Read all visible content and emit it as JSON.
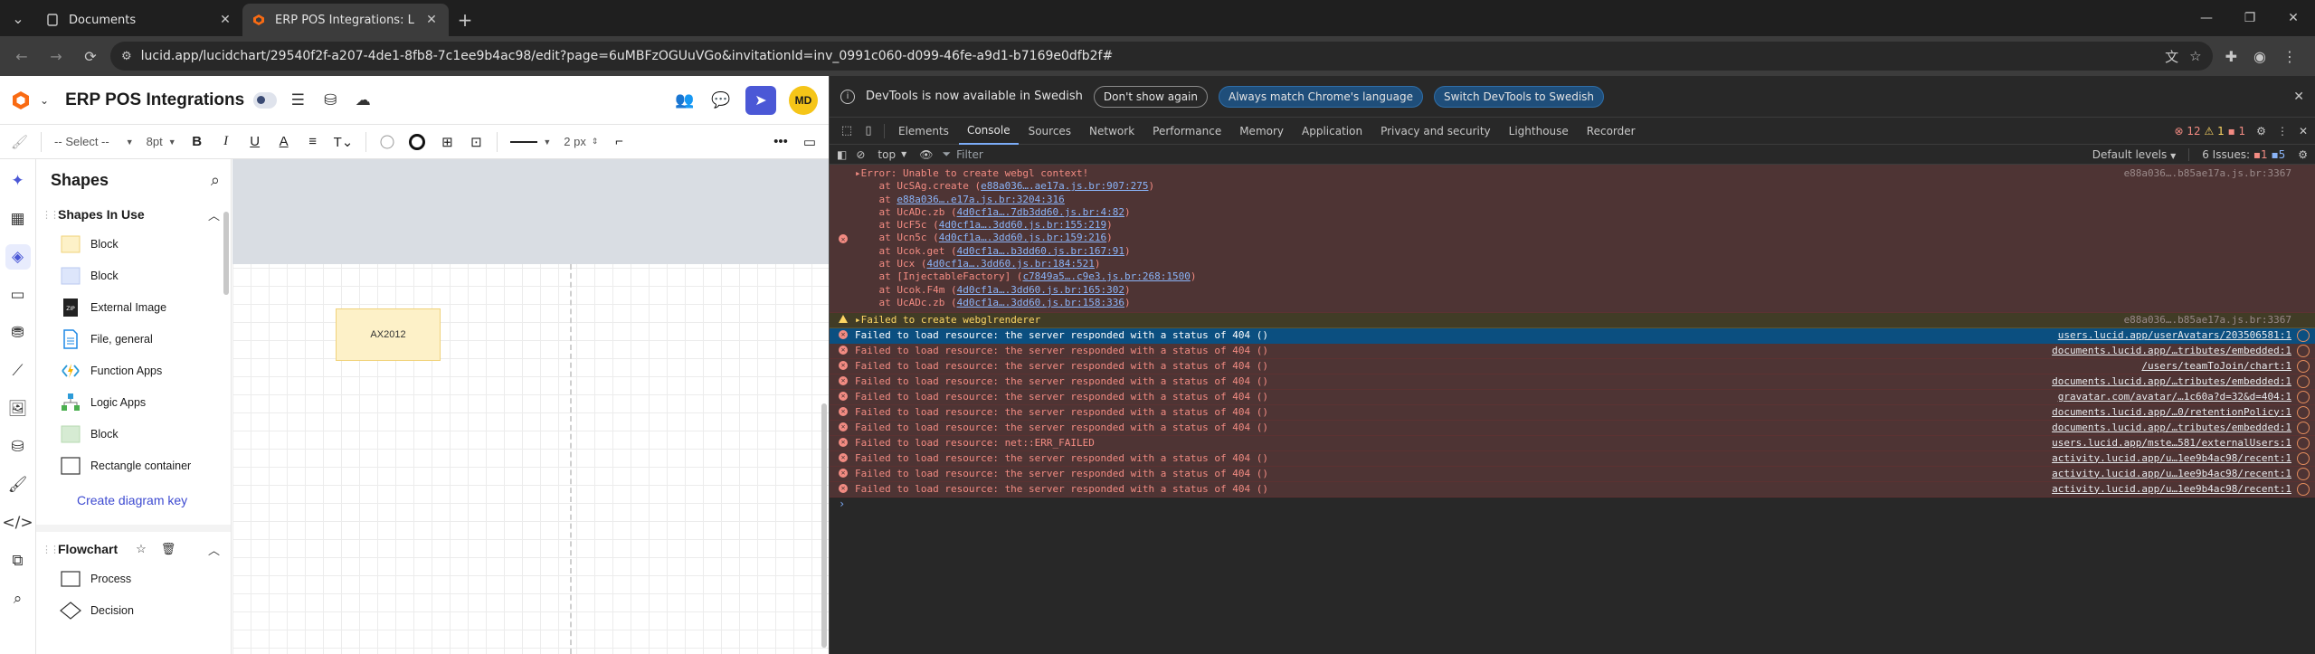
{
  "browser": {
    "tabs": [
      {
        "title": "Documents",
        "active": false
      },
      {
        "title": "ERP POS Integrations: Lucidcha",
        "active": true
      }
    ],
    "url": "lucid.app/lucidchart/29540f2f-a207-4de1-8fb8-7c1ee9b4ac98/edit?page=6uMBFzOGUuVGo&invitationId=inv_0991c060-d099-46fe-a9d1-b7169e0dfb2f#"
  },
  "lucid": {
    "doc_title": "ERP POS Integrations",
    "avatar": "MD",
    "toolbar": {
      "font_select": "-- Select --",
      "font_size": "8pt",
      "line_size": "2 px"
    },
    "panel_title": "Shapes",
    "shapes_in_use": {
      "title": "Shapes In Use",
      "items": [
        {
          "label": "Block",
          "swatch": "#fdf1c8"
        },
        {
          "label": "Block",
          "swatch": "#dde6fb"
        },
        {
          "label": "External Image",
          "swatch": "zip"
        },
        {
          "label": "File, general",
          "swatch": "file"
        },
        {
          "label": "Function Apps",
          "swatch": "fn"
        },
        {
          "label": "Logic Apps",
          "swatch": "logic"
        },
        {
          "label": "Block",
          "swatch": "#d6ebd3"
        },
        {
          "label": "Rectangle container",
          "swatch": "rect"
        }
      ]
    },
    "create_key": "Create diagram key",
    "flowchart": {
      "title": "Flowchart",
      "items": [
        {
          "label": "Process",
          "swatch": "rect"
        },
        {
          "label": "Decision",
          "swatch": "diamond"
        }
      ]
    },
    "canvas_shape_label": "AX2012"
  },
  "devtools": {
    "info_text": "DevTools is now available in Swedish",
    "btn_dont_show": "Don't show again",
    "btn_match": "Always match Chrome's language",
    "btn_switch": "Switch DevTools to Swedish",
    "tabs": [
      "Elements",
      "Console",
      "Sources",
      "Network",
      "Performance",
      "Memory",
      "Application",
      "Privacy and security",
      "Lighthouse",
      "Recorder"
    ],
    "active_tab": "Console",
    "counts": {
      "errors": "12",
      "warnings": "1",
      "info": "1"
    },
    "context": "top",
    "filter_placeholder": "Filter",
    "levels": "Default levels",
    "issues_label": "6 Issues:",
    "issues_err": "1",
    "issues_info": "5",
    "error_block": {
      "message": "Error: Unable to create webgl context!",
      "source": "e88a036….b85ae17a.js.br:3367",
      "stack": [
        {
          "pre": "    at UcSAg.create (",
          "link": "e88a036….ae17a.js.br:907:275",
          "post": ")"
        },
        {
          "pre": "    at ",
          "link": "e88a036….e17a.js.br:3204:316",
          "post": ""
        },
        {
          "pre": "    at UcADc.zb (",
          "link": "4d0cf1a….7db3dd60.js.br:4:82",
          "post": ")"
        },
        {
          "pre": "    at UcF5c (",
          "link": "4d0cf1a….3dd60.js.br:155:219",
          "post": ")"
        },
        {
          "pre": "    at Ucn5c (",
          "link": "4d0cf1a….3dd60.js.br:159:216",
          "post": ")"
        },
        {
          "pre": "    at Ucok.get (",
          "link": "4d0cf1a….b3dd60.js.br:167:91",
          "post": ")"
        },
        {
          "pre": "    at Ucx (",
          "link": "4d0cf1a….3dd60.js.br:184:521",
          "post": ")"
        },
        {
          "pre": "    at [InjectableFactory] (",
          "link": "c7849a5….c9e3.js.br:268:1500",
          "post": ")"
        },
        {
          "pre": "    at Ucok.F4m (",
          "link": "4d0cf1a….3dd60.js.br:165:302",
          "post": ")"
        },
        {
          "pre": "    at UcADc.zb (",
          "link": "4d0cf1a….3dd60.js.br:158:336",
          "post": ")"
        }
      ]
    },
    "warn_row": {
      "message": "Failed to create webglrenderer",
      "source": "e88a036….b85ae17a.js.br:3367"
    },
    "rows": [
      {
        "message": "Failed to load resource: the server responded with a status of 404 ()",
        "source": "users.lucid.app/userAvatars/203506581:1",
        "selected": true
      },
      {
        "message": "Failed to load resource: the server responded with a status of 404 ()",
        "source": "documents.lucid.app/…tributes/embedded:1"
      },
      {
        "message": "Failed to load resource: the server responded with a status of 404 ()",
        "source": "/users/teamToJoin/chart:1"
      },
      {
        "message": "Failed to load resource: the server responded with a status of 404 ()",
        "source": "documents.lucid.app/…tributes/embedded:1"
      },
      {
        "message": "Failed to load resource: the server responded with a status of 404 ()",
        "source": "gravatar.com/avatar/…1c60a?d=32&d=404:1"
      },
      {
        "message": "Failed to load resource: the server responded with a status of 404 ()",
        "source": "documents.lucid.app/…0/retentionPolicy:1"
      },
      {
        "message": "Failed to load resource: the server responded with a status of 404 ()",
        "source": "documents.lucid.app/…tributes/embedded:1"
      },
      {
        "message": "Failed to load resource: net::ERR_FAILED",
        "source": "users.lucid.app/mste…581/externalUsers:1"
      },
      {
        "message": "Failed to load resource: the server responded with a status of 404 ()",
        "source": "activity.lucid.app/u…1ee9b4ac98/recent:1"
      },
      {
        "message": "Failed to load resource: the server responded with a status of 404 ()",
        "source": "activity.lucid.app/u…1ee9b4ac98/recent:1"
      },
      {
        "message": "Failed to load resource: the server responded with a status of 404 ()",
        "source": "activity.lucid.app/u…1ee9b4ac98/recent:1"
      }
    ],
    "prompt": "›"
  },
  "colors": {
    "accent": "#4b58d6",
    "error_text": "#f28b82",
    "warn_text": "#fdd663",
    "selected_row": "#0b4f80"
  }
}
